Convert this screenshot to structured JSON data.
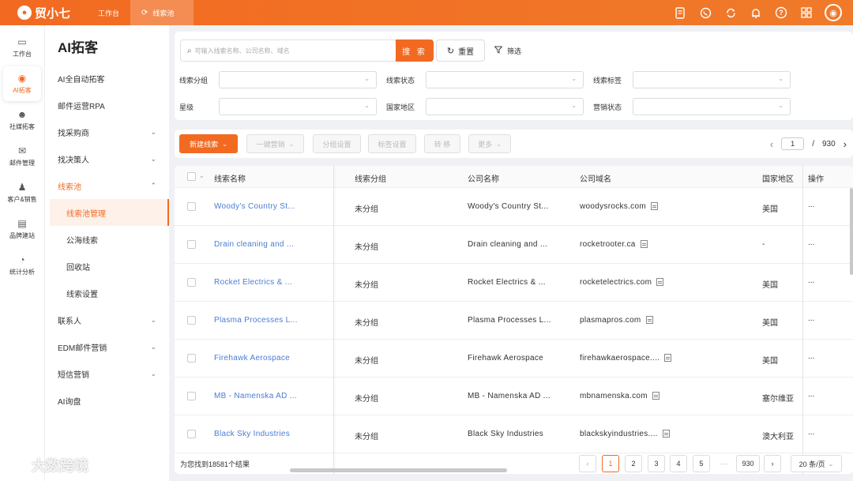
{
  "topbar": {
    "logo_text": "贸小七",
    "tabs": [
      {
        "label": "工作台"
      },
      {
        "label": "线索池"
      }
    ]
  },
  "rail": [
    {
      "label": "工作台",
      "icon": "monitor-icon"
    },
    {
      "label": "AI拓客",
      "icon": "robot-icon"
    },
    {
      "label": "社媒拓客",
      "icon": "people-icon"
    },
    {
      "label": "邮件管理",
      "icon": "mail-icon"
    },
    {
      "label": "客户&销售",
      "icon": "contact-icon"
    },
    {
      "label": "品牌建站",
      "icon": "chart-icon"
    },
    {
      "label": "统计分析",
      "icon": "pie-icon"
    }
  ],
  "menu": {
    "title": "AI拓客",
    "items": [
      {
        "label": "AI全自动拓客"
      },
      {
        "label": "邮件运营RPA"
      },
      {
        "label": "找采购商"
      },
      {
        "label": "找决策人"
      },
      {
        "label": "线索池"
      },
      {
        "label": "联系人"
      },
      {
        "label": "EDM邮件营销"
      },
      {
        "label": "短信营销"
      },
      {
        "label": "AI询盘"
      }
    ],
    "sub_items": [
      {
        "label": "线索池管理"
      },
      {
        "label": "公海线索"
      },
      {
        "label": "回收站"
      },
      {
        "label": "线索设置"
      }
    ]
  },
  "search": {
    "placeholder": "可输入线索名称、公司名称、域名",
    "search_label": "搜 索",
    "reset_label": "重置",
    "filter_label": "筛选"
  },
  "filters": {
    "group": "线索分组",
    "status": "线索状态",
    "tag": "线索标签",
    "star": "星级",
    "country": "国家地区",
    "marketing": "营销状态"
  },
  "actions": {
    "new_lead": "新建线索",
    "one_click": "一键营销",
    "group_setting": "分组设置",
    "tag_setting": "标签设置",
    "transfer": "转 移",
    "more": "更多"
  },
  "pager_top": {
    "current": "1",
    "total": "930",
    "sep": "/"
  },
  "table": {
    "columns": [
      "线索名称",
      "线索分组",
      "公司名称",
      "公司域名",
      "国家地区",
      "操作"
    ],
    "rows": [
      {
        "name": "Woody's Country St...",
        "group": "未分组",
        "company": "Woody's Country St...",
        "domain": "woodysrocks.com",
        "country": "美国",
        "op": "..."
      },
      {
        "name": "Drain cleaning and ...",
        "group": "未分组",
        "company": "Drain cleaning and ...",
        "domain": "rocketrooter.ca",
        "country": "-",
        "op": "..."
      },
      {
        "name": "Rocket Electrics & ...",
        "group": "未分组",
        "company": "Rocket Electrics & ...",
        "domain": "rocketelectrics.com",
        "country": "美国",
        "op": "..."
      },
      {
        "name": "Plasma Processes L...",
        "group": "未分组",
        "company": "Plasma Processes L...",
        "domain": "plasmapros.com",
        "country": "美国",
        "op": "..."
      },
      {
        "name": "Firehawk Aerospace",
        "group": "未分组",
        "company": "Firehawk Aerospace",
        "domain": "firehawkaerospace....",
        "country": "美国",
        "op": "..."
      },
      {
        "name": "MB - Namenska AD ...",
        "group": "未分组",
        "company": "MB - Namenska AD ...",
        "domain": "mbnamenska.com",
        "country": "塞尔维亚",
        "op": "..."
      },
      {
        "name": "Black Sky Industries",
        "group": "未分组",
        "company": "Black Sky Industries",
        "domain": "blackskyindustries....",
        "country": "澳大利亚",
        "op": "..."
      }
    ]
  },
  "footer": {
    "result_text": "为您找到18581个结果",
    "pages": [
      "1",
      "2",
      "3",
      "4",
      "5"
    ],
    "ellipsis": "···",
    "last_page": "930",
    "page_size": "20 条/页"
  },
  "watermark": "大数跨境"
}
